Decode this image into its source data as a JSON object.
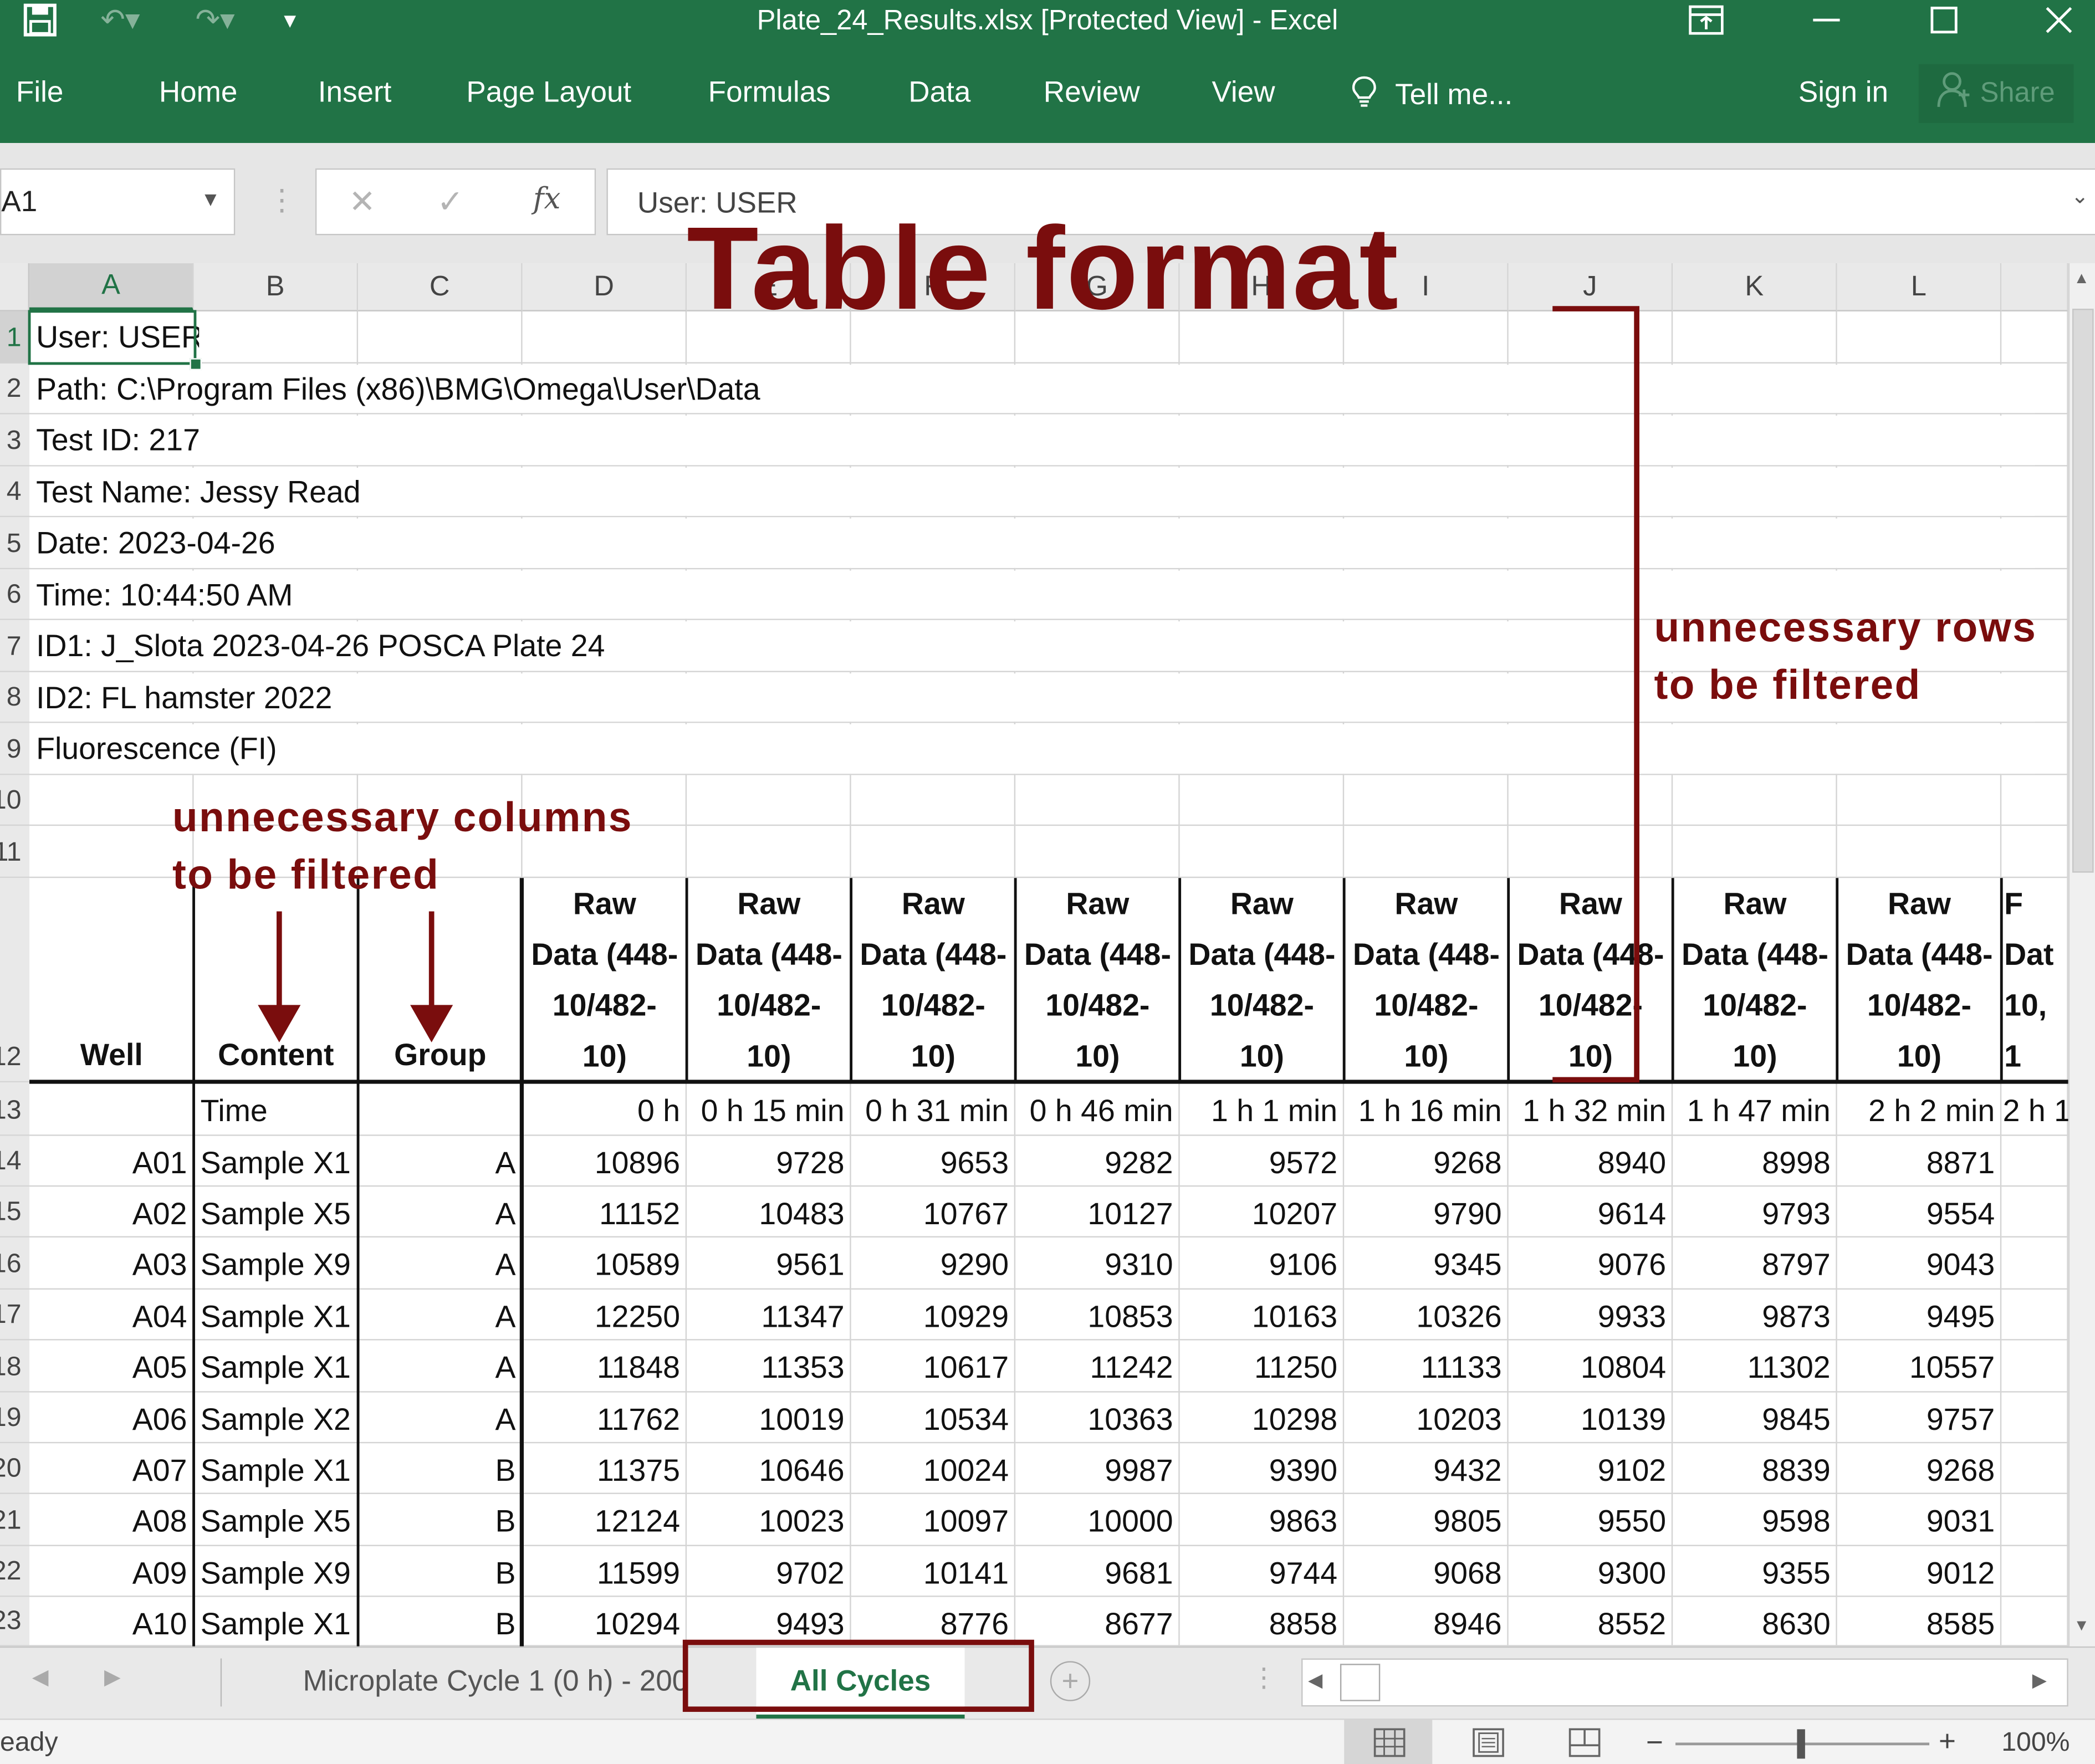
{
  "window": {
    "title": "Plate_24_Results.xlsx  [Protected View] - Excel",
    "quick_access_icons": [
      "save-icon",
      "undo-icon",
      "redo-icon",
      "customize-icon"
    ],
    "window_icons": [
      "ribbon-display-icon",
      "minimize-icon",
      "maximize-icon",
      "close-icon"
    ]
  },
  "ribbon": {
    "tabs": [
      "File",
      "Home",
      "Insert",
      "Page Layout",
      "Formulas",
      "Data",
      "Review",
      "View",
      "Tell me..."
    ],
    "sign_in": "Sign in",
    "share": "Share"
  },
  "formula_bar": {
    "name_box": "A1",
    "content": "User: USER",
    "fx_label": "fx"
  },
  "columns": [
    "A",
    "B",
    "C",
    "D",
    "E",
    "F",
    "G",
    "H",
    "I",
    "J",
    "K",
    "L"
  ],
  "row_numbers": [
    "1",
    "2",
    "3",
    "4",
    "5",
    "6",
    "7",
    "8",
    "9",
    "10",
    "11",
    "12",
    "13",
    "14",
    "15",
    "16",
    "17",
    "18",
    "19",
    "20",
    "21",
    "22",
    "23"
  ],
  "metadata_rows": [
    "User: USER",
    "Path: C:\\Program Files (x86)\\BMG\\Omega\\User\\Data",
    "Test ID: 217",
    "Test Name: Jessy Read",
    "Date: 2023-04-26",
    "Time: 10:44:50 AM",
    "ID1: J_Slota 2023-04-26 POSCA Plate 24",
    "ID2: FL hamster 2022",
    "Fluorescence (FI)"
  ],
  "table": {
    "header": {
      "well": "Well",
      "content": "Content",
      "group": "Group",
      "raw_line1": "Raw",
      "raw_line2": "Data (448-",
      "raw_line3": "10/482-",
      "raw_line4": "10)",
      "partial_line1": "F",
      "partial_line2": "Dat",
      "partial_line3": "10,",
      "partial_line4": "1"
    },
    "time_label": "Time",
    "times": [
      "0 h",
      "0 h 15 min",
      "0 h 31 min",
      "0 h 46 min",
      "1 h 1 min",
      "1 h 16 min",
      "1 h 32 min",
      "1 h 47 min",
      "2 h 2 min",
      "2 h 1"
    ],
    "rows": [
      {
        "well": "A01",
        "content": "Sample X1",
        "group": "A",
        "values": [
          "10896",
          "9728",
          "9653",
          "9282",
          "9572",
          "9268",
          "8940",
          "8998",
          "8871"
        ]
      },
      {
        "well": "A02",
        "content": "Sample X5",
        "group": "A",
        "values": [
          "11152",
          "10483",
          "10767",
          "10127",
          "10207",
          "9790",
          "9614",
          "9793",
          "9554"
        ]
      },
      {
        "well": "A03",
        "content": "Sample X9",
        "group": "A",
        "values": [
          "10589",
          "9561",
          "9290",
          "9310",
          "9106",
          "9345",
          "9076",
          "8797",
          "9043"
        ]
      },
      {
        "well": "A04",
        "content": "Sample X1",
        "group": "A",
        "values": [
          "12250",
          "11347",
          "10929",
          "10853",
          "10163",
          "10326",
          "9933",
          "9873",
          "9495"
        ]
      },
      {
        "well": "A05",
        "content": "Sample X1",
        "group": "A",
        "values": [
          "11848",
          "11353",
          "10617",
          "11242",
          "11250",
          "11133",
          "10804",
          "11302",
          "10557"
        ]
      },
      {
        "well": "A06",
        "content": "Sample X2",
        "group": "A",
        "values": [
          "11762",
          "10019",
          "10534",
          "10363",
          "10298",
          "10203",
          "10139",
          "9845",
          "9757"
        ]
      },
      {
        "well": "A07",
        "content": "Sample X1",
        "group": "B",
        "values": [
          "11375",
          "10646",
          "10024",
          "9987",
          "9390",
          "9432",
          "9102",
          "8839",
          "9268"
        ]
      },
      {
        "well": "A08",
        "content": "Sample X5",
        "group": "B",
        "values": [
          "12124",
          "10023",
          "10097",
          "10000",
          "9863",
          "9805",
          "9550",
          "9598",
          "9031"
        ]
      },
      {
        "well": "A09",
        "content": "Sample X9",
        "group": "B",
        "values": [
          "11599",
          "9702",
          "10141",
          "9681",
          "9744",
          "9068",
          "9300",
          "9355",
          "9012"
        ]
      },
      {
        "well": "A10",
        "content": "Sample X1",
        "group": "B",
        "values": [
          "10294",
          "9493",
          "8776",
          "8677",
          "8858",
          "8946",
          "8552",
          "8630",
          "8585"
        ]
      }
    ]
  },
  "sheet_tabs": [
    "Microplate Cycle 1 (0 h) - 200",
    "All Cycles"
  ],
  "active_sheet": "All Cycles",
  "status": {
    "ready": "eady",
    "zoom": "100%"
  },
  "annotations": {
    "title": "Table format",
    "rows_note_line1": "unnecessary rows",
    "rows_note_line2": "to be filtered",
    "cols_note_line1": "unnecessary columns",
    "cols_note_line2": "to be filtered"
  },
  "colors": {
    "excel_green": "#217346",
    "annotation_red": "#7a0d0d",
    "grid_line": "#d4d4d4"
  }
}
